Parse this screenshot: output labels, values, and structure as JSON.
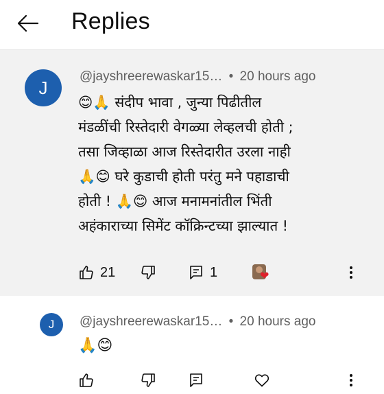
{
  "header": {
    "back_icon": "arrow-left-icon",
    "title": "Replies"
  },
  "main_comment": {
    "avatar_letter": "J",
    "avatar_color": "#1d5fae",
    "author": "@jayshreerewaskar15…",
    "separator": "•",
    "time": "20 hours ago",
    "lines": [
      "😊🙏 संदीप भावा , जुन्या पिढीतील",
      "मंडळींची रिस्तेदारी वेगळ्या लेव्हलची होती ;",
      "तसा जिव्हाळा आज रिस्तेदारीत उरला नाही",
      "🙏😊 घरे कुडाची होती परंतु मने पहाडाची",
      "होती ! 🙏😊 आज मनामनांतील भिंती",
      "अहंकाराच्या सिमेंट कॉक्रिन्टच्या झाल्यात !"
    ],
    "likes": "21",
    "replies": "1",
    "icons": [
      "thumb-up-icon",
      "thumb-down-icon",
      "comment-icon",
      "creator-heart-icon",
      "more-vert-icon"
    ]
  },
  "reply": {
    "avatar_letter": "J",
    "avatar_color": "#1d5fae",
    "author": "@jayshreerewaskar15…",
    "separator": "•",
    "time": "20 hours ago",
    "text": "🙏😊",
    "icons": [
      "thumb-up-icon",
      "thumb-down-icon",
      "comment-icon",
      "heart-icon",
      "more-vert-icon"
    ]
  },
  "colors": {
    "highlight_bg": "#f2f2f2",
    "meta_text": "#606060",
    "heart": "#e0202a"
  }
}
